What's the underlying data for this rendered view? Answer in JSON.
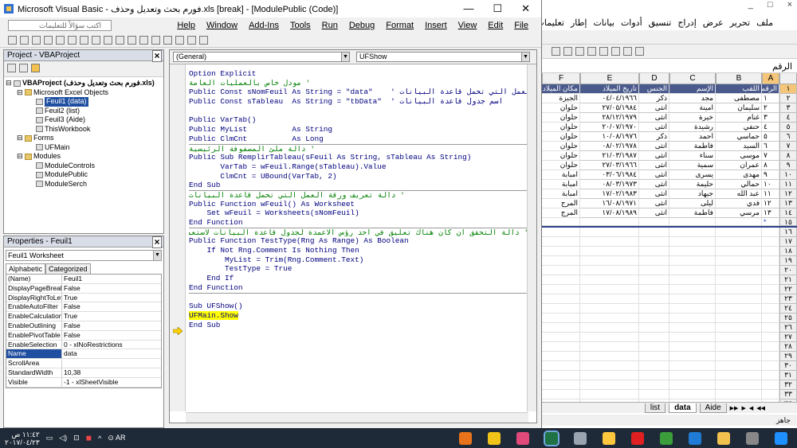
{
  "vbe": {
    "title": "Microsoft Visual Basic - فورم بحث وتعديل وحذف.xls [break] - [ModulePublic (Code)]",
    "ask_placeholder": "اكتب سؤالاً للتعليمات",
    "menus": [
      "Help",
      "Window",
      "Add-Ins",
      "Tools",
      "Run",
      "Debug",
      "Format",
      "Insert",
      "View",
      "Edit",
      "File"
    ],
    "project_pane_title": "Project - VBAProject",
    "tree": [
      {
        "label": "VBAProject (فورم بحث وتعديل وحذف.xls)",
        "bold": true,
        "depth": 0,
        "folder": false
      },
      {
        "label": "Microsoft Excel Objects",
        "depth": 1,
        "folder": true
      },
      {
        "label": "Feuil1 (data)",
        "depth": 2,
        "selected": true
      },
      {
        "label": "Feuil2 (list)",
        "depth": 2
      },
      {
        "label": "Feuil3 (Aide)",
        "depth": 2
      },
      {
        "label": "ThisWorkbook",
        "depth": 2
      },
      {
        "label": "Forms",
        "depth": 1,
        "folder": true
      },
      {
        "label": "UFMain",
        "depth": 2
      },
      {
        "label": "Modules",
        "depth": 1,
        "folder": true
      },
      {
        "label": "ModuleControls",
        "depth": 2
      },
      {
        "label": "ModulePublic",
        "depth": 2
      },
      {
        "label": "ModuleSerch",
        "depth": 2
      }
    ],
    "props_title": "Properties - Feuil1",
    "props_combo": "Feuil1 Worksheet",
    "props_tabs": [
      "Alphabetic",
      "Categorized"
    ],
    "props": [
      {
        "k": "(Name)",
        "v": "Feuil1"
      },
      {
        "k": "DisplayPageBreaks",
        "v": "False"
      },
      {
        "k": "DisplayRightToLeft",
        "v": "True"
      },
      {
        "k": "EnableAutoFilter",
        "v": "False"
      },
      {
        "k": "EnableCalculation",
        "v": "True"
      },
      {
        "k": "EnableOutlining",
        "v": "False"
      },
      {
        "k": "EnablePivotTable",
        "v": "False"
      },
      {
        "k": "EnableSelection",
        "v": "0 - xlNoRestrictions"
      },
      {
        "k": "Name",
        "v": "data",
        "selected": true
      },
      {
        "k": "ScrollArea",
        "v": ""
      },
      {
        "k": "StandardWidth",
        "v": "10,38"
      },
      {
        "k": "Visible",
        "v": "-1 - xlSheetVisible"
      }
    ],
    "code_combo_left": "(General)",
    "code_combo_right": "UFShow",
    "code": [
      {
        "t": "Option Explicit"
      },
      {
        "t": "' مودل خاص بالعمليات العامة",
        "c": true
      },
      {
        "t": "Public Const sNomFeuil As String = \"data\"    ' اسم ورقة العمل التي تحمل قاعدة البيانات"
      },
      {
        "t": "Public Const sTableau  As String = \"tbData\"  ' اسم جدول قاعدة البيانات"
      },
      {
        "t": ""
      },
      {
        "t": "Public VarTab()"
      },
      {
        "t": "Public MyList          As String"
      },
      {
        "t": "Public ClmCnt          As Long"
      },
      {
        "t": "' دالة ملئ المصفوفة الرئيسية",
        "c": true,
        "sep": true
      },
      {
        "t": "Public Sub RemplirTableau(sFeuil As String, sTableau As String)"
      },
      {
        "t": "       VarTab = wFeuil.Range(sTableau).Value"
      },
      {
        "t": "       ClmCnt = UBound(VarTab, 2)"
      },
      {
        "t": "End Sub"
      },
      {
        "t": "' دالة تعريف ورقة العمل التي تحمل قاعدة البيانات",
        "c": true,
        "sep": true
      },
      {
        "t": "Public Function wFeuil() As Worksheet"
      },
      {
        "t": "    Set wFeuil = Worksheets(sNomFeuil)"
      },
      {
        "t": "End Function"
      },
      {
        "t": "' دالة التحقق ان كان هناك تعليق في احد رؤس الاعمدة لجدول قاعدة البيانات لاستعمالها كقوائم",
        "c": true,
        "sep": true
      },
      {
        "t": "Public Function TestType(Rng As Range) As Boolean"
      },
      {
        "t": "    If Not Rng.Comment Is Nothing Then"
      },
      {
        "t": "        MyList = Trim(Rng.Comment.Text)"
      },
      {
        "t": "        TestType = True"
      },
      {
        "t": "    End If"
      },
      {
        "t": "End Function"
      },
      {
        "t": "",
        "sep": true
      },
      {
        "t": "Sub UFShow()"
      },
      {
        "t": "UFMain.Show",
        "hl": true
      },
      {
        "t": "End Sub"
      }
    ]
  },
  "excel": {
    "menus": [
      "ملف",
      "تحرير",
      "عرض",
      "إدراج",
      "تنسيق",
      "أدوات",
      "بيانات",
      "إطار",
      "تعليمات"
    ],
    "caption_buttons": [
      "_",
      "□",
      "×"
    ],
    "namebox": "الرقم",
    "col_headers": [
      "A",
      "B",
      "C",
      "D",
      "E",
      "F"
    ],
    "table_header": [
      "الرقم",
      "اللقب",
      "الإسم",
      "الجنس",
      "تاريخ الميلاد",
      "مكان الميلاد"
    ],
    "rows": [
      [
        "١",
        "مصطفى",
        "مجد",
        "ذكر",
        "٠٤/٠٤/١٩٦٦",
        "الجيزة"
      ],
      [
        "٢",
        "سليمان",
        "امينة",
        "انثى",
        "٢٧/٠٥/١٩٨٤",
        "حلوان"
      ],
      [
        "٣",
        "غنام",
        "خيرة",
        "انثى",
        "٢٨/١٢/١٩٧٩",
        "حلوان"
      ],
      [
        "٤",
        "حنفي",
        "رشيدة",
        "انثى",
        "٢٠/٠٧/١٩٧٠",
        "حلوان"
      ],
      [
        "٥",
        "حماسي",
        "احمد",
        "ذكر",
        "١٠/٠٨/١٩٧٦",
        "حلوان"
      ],
      [
        "٦",
        "السيد",
        "فاطمة",
        "انثى",
        "٠٨/٠٢/١٩٧٨",
        "حلوان"
      ],
      [
        "٧",
        "موسى",
        "سناء",
        "انثى",
        "٢١/٠٣/١٩٨٧",
        "حلوان"
      ],
      [
        "٨",
        "عمران",
        "سمية",
        "انثى",
        "٢٧/٠٣/١٩٦٦",
        "حلوان"
      ],
      [
        "٩",
        "مهدى",
        "يسرى",
        "انثى",
        "٠٣/٠٦/١٩٨٤",
        "امبابة"
      ],
      [
        "١٠",
        "حمالي",
        "حليمة",
        "انثى",
        "٠٨/٠٣/١٩٧٣",
        "امبابة"
      ],
      [
        "١١",
        "عبد الله",
        "جيهاد",
        "انثى",
        "١٧/٠٢/١٩٨٣",
        "امبابة"
      ],
      [
        "١٢",
        "فدي",
        "ليلى",
        "انثى",
        "١٦/٠٨/١٩٧١",
        "المرج"
      ],
      [
        "١٣",
        "مرسي",
        "فاطمة",
        "انثى",
        "١٧/٠٨/١٩٨٩",
        "المرج"
      ],
      [
        "*",
        "",
        "",
        "",
        "",
        ""
      ]
    ],
    "row_numbers": [
      "١",
      "٢",
      "٣",
      "٤",
      "٥",
      "٦",
      "٧",
      "٨",
      "٩",
      "١٠",
      "١١",
      "١٢",
      "١٣",
      "١٤",
      "١٥",
      "١٦",
      "١٧",
      "١٨",
      "١٩",
      "٢٠",
      "٢١",
      "٢٢",
      "٢٣",
      "٢٤",
      "٢٥",
      "٢٦",
      "٢٧",
      "٢٨",
      "٢٩",
      "٣٠",
      "٣١",
      "٣٢",
      "٣٣",
      "٣٤"
    ],
    "sheet_tabs": [
      "list",
      "data",
      "Aide"
    ],
    "active_sheet": "data",
    "status": "جاهز"
  },
  "taskbar": {
    "time": "١١:٤٢ ص",
    "date": "٢٠١٧/٠٤/٢٣",
    "lang": "AR",
    "apps": [
      "firefox",
      "unknown",
      "colors",
      "excel",
      "vbe",
      "unknown2",
      "record",
      "chrome",
      "ie",
      "folder",
      "mail",
      "windows"
    ],
    "app_colors": [
      "#e8731a",
      "#f0c419",
      "#e04a7a",
      "#1f7244",
      "#9aa3b0",
      "#ffc83d",
      "#e02020",
      "#3b9e3b",
      "#1f7bd6",
      "#f2c14e",
      "#888",
      "#1e90ff"
    ]
  }
}
